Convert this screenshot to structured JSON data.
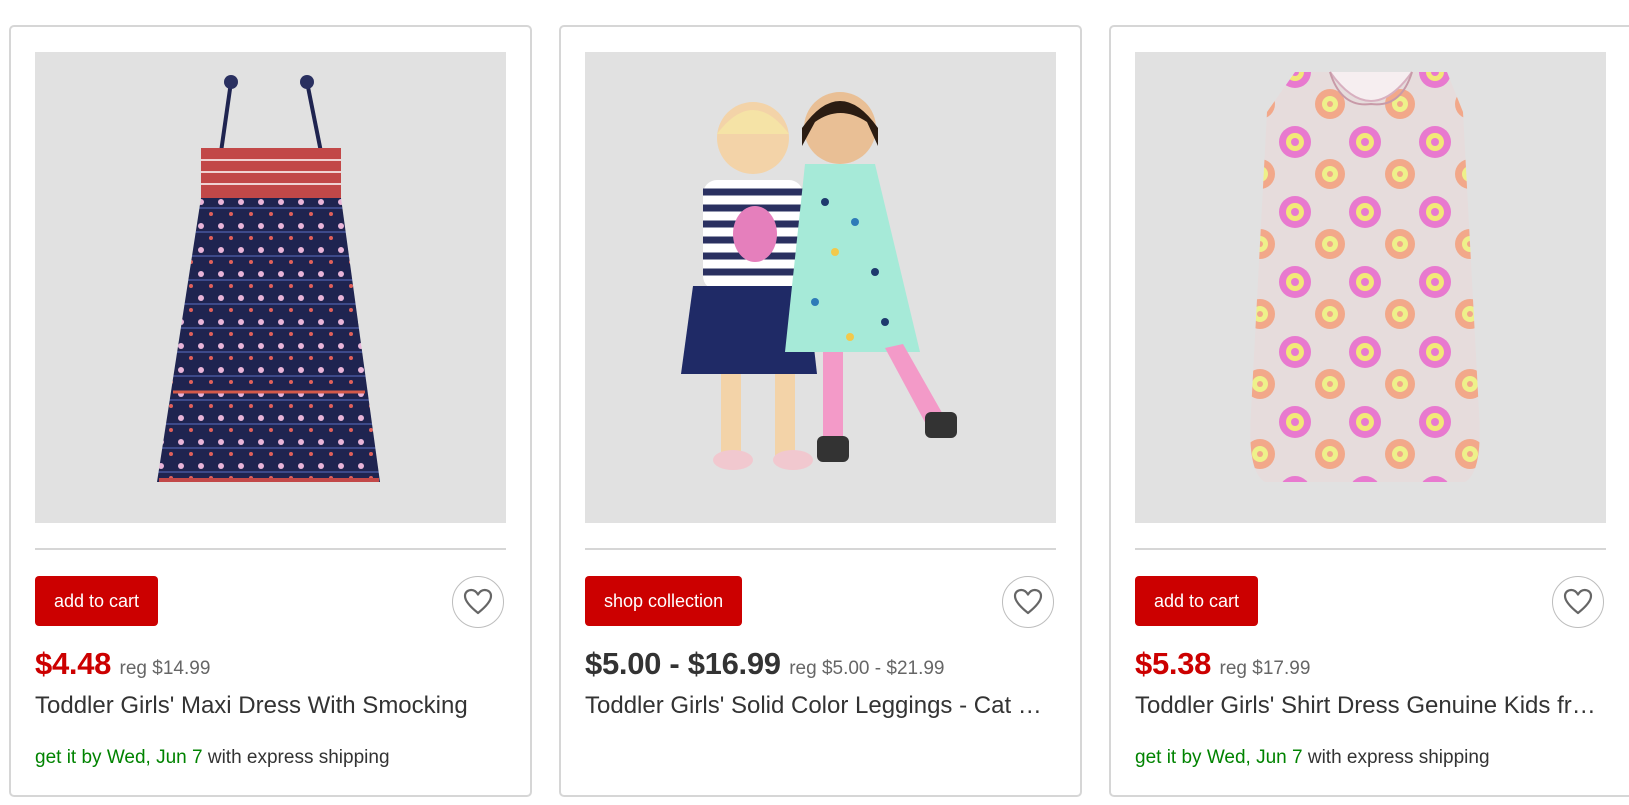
{
  "colors": {
    "accent_red": "#cc0000",
    "ship_green": "#008300",
    "text_dark": "#333333",
    "text_muted": "#666666",
    "image_bg": "#e1e1e1",
    "border": "#d6d6d6"
  },
  "products": [
    {
      "cta_label": "add to cart",
      "price": "$4.48",
      "price_style": "sale",
      "reg_price": "reg $14.99",
      "title": "Toddler Girls' Maxi Dress With Smocking",
      "shipping": {
        "lead": "get it by Wed, Jun 7",
        "tail": " with express shipping"
      },
      "favorite_icon": "heart-outline-icon"
    },
    {
      "cta_label": "shop collection",
      "price": "$5.00 - $16.99",
      "price_style": "normal",
      "reg_price": "reg $5.00 - $21.99",
      "title": "Toddler Girls' Solid Color Leggings - Cat & Jack",
      "shipping": null,
      "favorite_icon": "heart-outline-icon"
    },
    {
      "cta_label": "add to cart",
      "price": "$5.38",
      "price_style": "sale",
      "reg_price": "reg $17.99",
      "title": "Toddler Girls' Shirt Dress Genuine Kids from OshKosh",
      "shipping": {
        "lead": "get it by Wed, Jun 7",
        "tail": " with express shipping"
      },
      "favorite_icon": "heart-outline-icon"
    }
  ]
}
